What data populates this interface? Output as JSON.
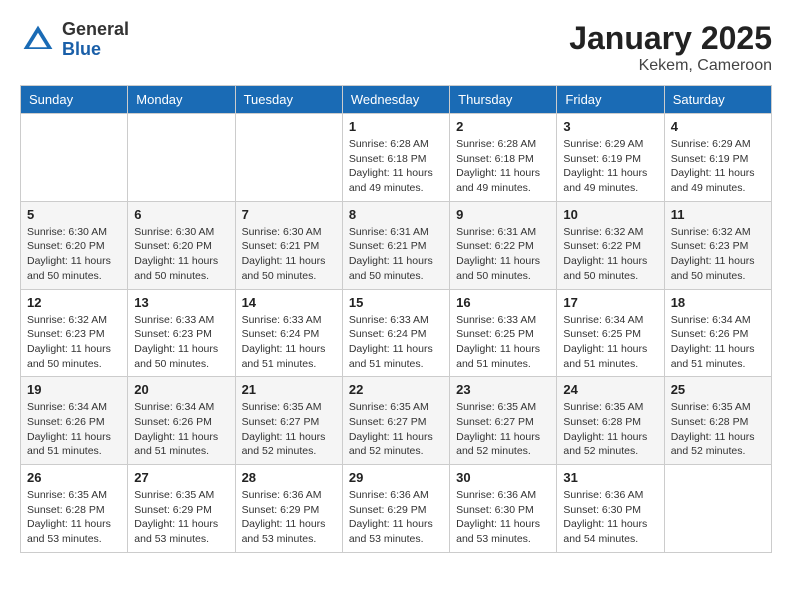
{
  "header": {
    "logo_general": "General",
    "logo_blue": "Blue",
    "month_title": "January 2025",
    "location": "Kekem, Cameroon"
  },
  "weekdays": [
    "Sunday",
    "Monday",
    "Tuesday",
    "Wednesday",
    "Thursday",
    "Friday",
    "Saturday"
  ],
  "weeks": [
    [
      {
        "day": "",
        "info": ""
      },
      {
        "day": "",
        "info": ""
      },
      {
        "day": "",
        "info": ""
      },
      {
        "day": "1",
        "info": "Sunrise: 6:28 AM\nSunset: 6:18 PM\nDaylight: 11 hours\nand 49 minutes."
      },
      {
        "day": "2",
        "info": "Sunrise: 6:28 AM\nSunset: 6:18 PM\nDaylight: 11 hours\nand 49 minutes."
      },
      {
        "day": "3",
        "info": "Sunrise: 6:29 AM\nSunset: 6:19 PM\nDaylight: 11 hours\nand 49 minutes."
      },
      {
        "day": "4",
        "info": "Sunrise: 6:29 AM\nSunset: 6:19 PM\nDaylight: 11 hours\nand 49 minutes."
      }
    ],
    [
      {
        "day": "5",
        "info": "Sunrise: 6:30 AM\nSunset: 6:20 PM\nDaylight: 11 hours\nand 50 minutes."
      },
      {
        "day": "6",
        "info": "Sunrise: 6:30 AM\nSunset: 6:20 PM\nDaylight: 11 hours\nand 50 minutes."
      },
      {
        "day": "7",
        "info": "Sunrise: 6:30 AM\nSunset: 6:21 PM\nDaylight: 11 hours\nand 50 minutes."
      },
      {
        "day": "8",
        "info": "Sunrise: 6:31 AM\nSunset: 6:21 PM\nDaylight: 11 hours\nand 50 minutes."
      },
      {
        "day": "9",
        "info": "Sunrise: 6:31 AM\nSunset: 6:22 PM\nDaylight: 11 hours\nand 50 minutes."
      },
      {
        "day": "10",
        "info": "Sunrise: 6:32 AM\nSunset: 6:22 PM\nDaylight: 11 hours\nand 50 minutes."
      },
      {
        "day": "11",
        "info": "Sunrise: 6:32 AM\nSunset: 6:23 PM\nDaylight: 11 hours\nand 50 minutes."
      }
    ],
    [
      {
        "day": "12",
        "info": "Sunrise: 6:32 AM\nSunset: 6:23 PM\nDaylight: 11 hours\nand 50 minutes."
      },
      {
        "day": "13",
        "info": "Sunrise: 6:33 AM\nSunset: 6:23 PM\nDaylight: 11 hours\nand 50 minutes."
      },
      {
        "day": "14",
        "info": "Sunrise: 6:33 AM\nSunset: 6:24 PM\nDaylight: 11 hours\nand 51 minutes."
      },
      {
        "day": "15",
        "info": "Sunrise: 6:33 AM\nSunset: 6:24 PM\nDaylight: 11 hours\nand 51 minutes."
      },
      {
        "day": "16",
        "info": "Sunrise: 6:33 AM\nSunset: 6:25 PM\nDaylight: 11 hours\nand 51 minutes."
      },
      {
        "day": "17",
        "info": "Sunrise: 6:34 AM\nSunset: 6:25 PM\nDaylight: 11 hours\nand 51 minutes."
      },
      {
        "day": "18",
        "info": "Sunrise: 6:34 AM\nSunset: 6:26 PM\nDaylight: 11 hours\nand 51 minutes."
      }
    ],
    [
      {
        "day": "19",
        "info": "Sunrise: 6:34 AM\nSunset: 6:26 PM\nDaylight: 11 hours\nand 51 minutes."
      },
      {
        "day": "20",
        "info": "Sunrise: 6:34 AM\nSunset: 6:26 PM\nDaylight: 11 hours\nand 51 minutes."
      },
      {
        "day": "21",
        "info": "Sunrise: 6:35 AM\nSunset: 6:27 PM\nDaylight: 11 hours\nand 52 minutes."
      },
      {
        "day": "22",
        "info": "Sunrise: 6:35 AM\nSunset: 6:27 PM\nDaylight: 11 hours\nand 52 minutes."
      },
      {
        "day": "23",
        "info": "Sunrise: 6:35 AM\nSunset: 6:27 PM\nDaylight: 11 hours\nand 52 minutes."
      },
      {
        "day": "24",
        "info": "Sunrise: 6:35 AM\nSunset: 6:28 PM\nDaylight: 11 hours\nand 52 minutes."
      },
      {
        "day": "25",
        "info": "Sunrise: 6:35 AM\nSunset: 6:28 PM\nDaylight: 11 hours\nand 52 minutes."
      }
    ],
    [
      {
        "day": "26",
        "info": "Sunrise: 6:35 AM\nSunset: 6:28 PM\nDaylight: 11 hours\nand 53 minutes."
      },
      {
        "day": "27",
        "info": "Sunrise: 6:35 AM\nSunset: 6:29 PM\nDaylight: 11 hours\nand 53 minutes."
      },
      {
        "day": "28",
        "info": "Sunrise: 6:36 AM\nSunset: 6:29 PM\nDaylight: 11 hours\nand 53 minutes."
      },
      {
        "day": "29",
        "info": "Sunrise: 6:36 AM\nSunset: 6:29 PM\nDaylight: 11 hours\nand 53 minutes."
      },
      {
        "day": "30",
        "info": "Sunrise: 6:36 AM\nSunset: 6:30 PM\nDaylight: 11 hours\nand 53 minutes."
      },
      {
        "day": "31",
        "info": "Sunrise: 6:36 AM\nSunset: 6:30 PM\nDaylight: 11 hours\nand 54 minutes."
      },
      {
        "day": "",
        "info": ""
      }
    ]
  ]
}
